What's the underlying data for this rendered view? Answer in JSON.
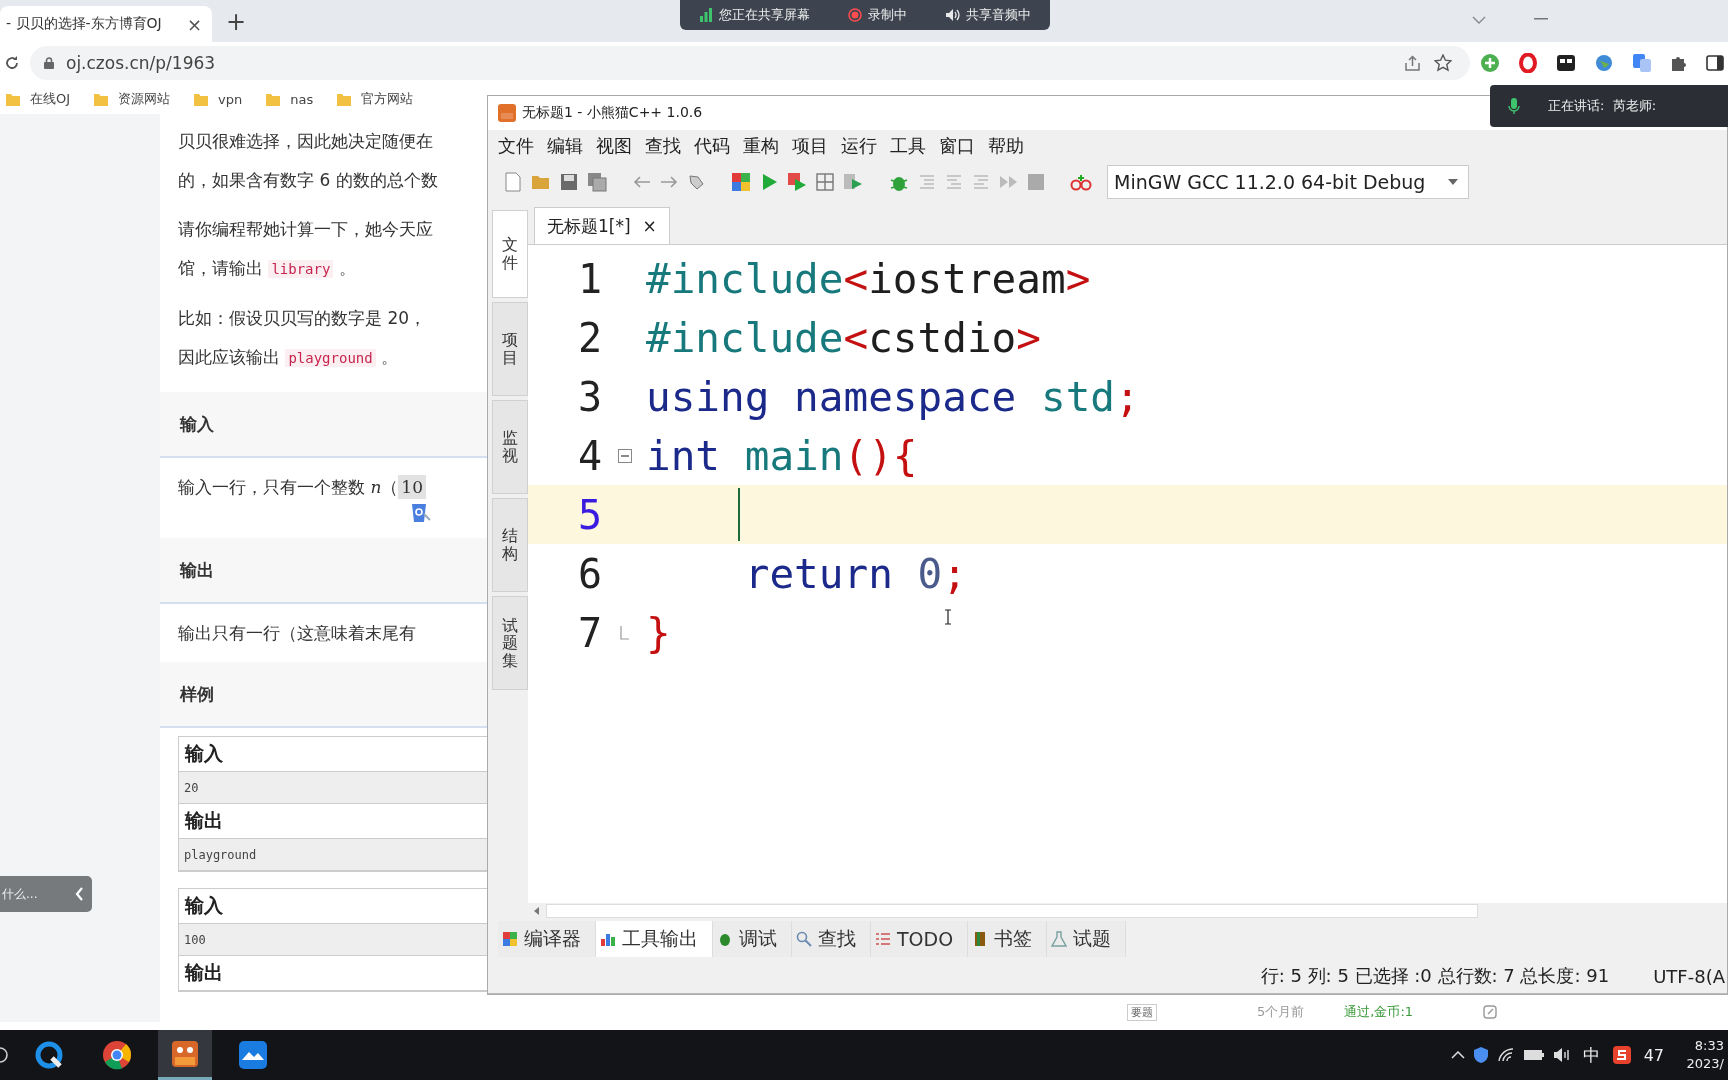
{
  "browser": {
    "tab_title": "- 贝贝的选择-东方博育OJ",
    "tab_close": "×",
    "new_tab": "+",
    "url": "oj.czos.cn/p/1963",
    "bookmarks": [
      "在线OJ",
      "资源网站",
      "vpn",
      "nas",
      "官方网站"
    ]
  },
  "share_banner": [
    {
      "kind": "sharing",
      "label": "您正在共享屏幕"
    },
    {
      "kind": "recording",
      "label": "录制中"
    },
    {
      "kind": "audio",
      "label": "共享音频中"
    }
  ],
  "speaking": {
    "label": "正在讲话:  芮老师:"
  },
  "problem": {
    "paragraphs": [
      [
        {
          "kind": "text",
          "text": "贝贝很难选择，因此她决定随便在"
        }
      ],
      [
        {
          "kind": "text",
          "text": "的，如果含有数字 6 的数的总个数"
        }
      ],
      [
        {
          "kind": "text",
          "text": "请你编程帮她计算一下，她今天应"
        }
      ],
      [
        {
          "kind": "text",
          "text": "馆，请输出 "
        },
        {
          "kind": "code",
          "text": "library"
        },
        {
          "kind": "text",
          "text": " 。"
        }
      ],
      [
        {
          "kind": "text",
          "text": "比如：假设贝贝写的数字是 20，"
        }
      ],
      [
        {
          "kind": "text",
          "text": "因此应该输出 "
        },
        {
          "kind": "code",
          "text": "playground"
        },
        {
          "kind": "text",
          "text": " 。"
        }
      ]
    ],
    "sections": [
      {
        "heading": "输入",
        "body": [
          {
            "kind": "text",
            "text": "输入一行，只有一个整数 "
          },
          {
            "kind": "var",
            "text": "n"
          },
          {
            "kind": "text",
            "text": "（"
          },
          {
            "kind": "mathbox",
            "text": "10"
          }
        ]
      },
      {
        "heading": "输出",
        "body": [
          {
            "kind": "text",
            "text": "输出只有一行（这意味着末尾有"
          }
        ]
      },
      {
        "heading": "样例"
      }
    ],
    "samples": [
      {
        "rows": [
          {
            "kind": "label",
            "text": "输入"
          },
          {
            "kind": "data",
            "text": "20"
          },
          {
            "kind": "label",
            "text": "输出"
          },
          {
            "kind": "data",
            "text": "playground"
          }
        ]
      },
      {
        "rows": [
          {
            "kind": "label",
            "text": "输入"
          },
          {
            "kind": "data",
            "text": "100"
          },
          {
            "kind": "label",
            "text": "输出"
          }
        ]
      }
    ],
    "side_panel": {
      "label": "什么..."
    },
    "record": {
      "button": "要题",
      "time": "5个月前",
      "result": "通过,金币:1"
    }
  },
  "ide": {
    "title": "无标题1  - 小熊猫C++ 1.0.6",
    "menu": [
      "文件",
      "编辑",
      "视图",
      "查找",
      "代码",
      "重构",
      "项目",
      "运行",
      "工具",
      "窗口",
      "帮助"
    ],
    "compiler": "MinGW GCC 11.2.0 64-bit Debug",
    "side_tabs": [
      {
        "label": "文件",
        "selected": true
      },
      {
        "label": "项目",
        "selected": false
      },
      {
        "label": "监视",
        "selected": false
      },
      {
        "label": "结构",
        "selected": false
      },
      {
        "label": "试题集",
        "selected": false
      }
    ],
    "file_tab": {
      "label": "无标题1[*]",
      "close": "×"
    },
    "lines": [
      {
        "number": "1",
        "kind": "line",
        "current": false,
        "tokens": [
          {
            "kind": "directive",
            "text": "#include"
          },
          {
            "kind": "bracket",
            "text": "<"
          },
          {
            "kind": "header",
            "text": "iostream"
          },
          {
            "kind": "bracket",
            "text": ">"
          }
        ]
      },
      {
        "number": "2",
        "kind": "line",
        "current": false,
        "tokens": [
          {
            "kind": "directive",
            "text": "#include"
          },
          {
            "kind": "bracket",
            "text": "<"
          },
          {
            "kind": "header",
            "text": "cstdio"
          },
          {
            "kind": "bracket",
            "text": ">"
          }
        ]
      },
      {
        "number": "3",
        "kind": "line",
        "current": false,
        "tokens": [
          {
            "kind": "keyword",
            "text": "using namespace"
          },
          {
            "kind": "ident",
            "text": " std"
          },
          {
            "kind": "bracket",
            "text": ";"
          }
        ]
      },
      {
        "number": "4",
        "kind": "fold",
        "current": false,
        "tokens": [
          {
            "kind": "keyword",
            "text": "int"
          },
          {
            "kind": "ident",
            "text": " main"
          },
          {
            "kind": "bracket",
            "text": "(){"
          }
        ]
      },
      {
        "number": "5",
        "kind": "line",
        "current": true
      },
      {
        "number": "6",
        "kind": "line",
        "current": false,
        "tokens": [
          {
            "kind": "keyword",
            "text": "    return"
          },
          {
            "kind": "number",
            "text": " 0"
          },
          {
            "kind": "bracket",
            "text": ";"
          }
        ]
      },
      {
        "number": "7",
        "kind": "fold_end",
        "current": false,
        "tokens": [
          {
            "kind": "bracket",
            "text": "}"
          }
        ]
      }
    ],
    "bottom_tabs": [
      {
        "kind": "compiler",
        "label": "编译器",
        "selected": false
      },
      {
        "kind": "tools",
        "label": "工具输出",
        "selected": true
      },
      {
        "kind": "debug",
        "label": "调试",
        "selected": false
      },
      {
        "kind": "search",
        "label": "查找",
        "selected": false
      },
      {
        "kind": "todo",
        "label": "TODO",
        "selected": false
      },
      {
        "kind": "bookmark",
        "label": "书签",
        "selected": false
      },
      {
        "kind": "problem",
        "label": "试题",
        "selected": false
      }
    ],
    "status": {
      "position": "行: 5 列: 5 已选择 :0 总行数: 7 总长度: 91",
      "encoding": "UTF-8(A"
    }
  },
  "taskbar": {
    "ime": "中",
    "badge": "47",
    "time": "8:33",
    "date": "2023/"
  }
}
